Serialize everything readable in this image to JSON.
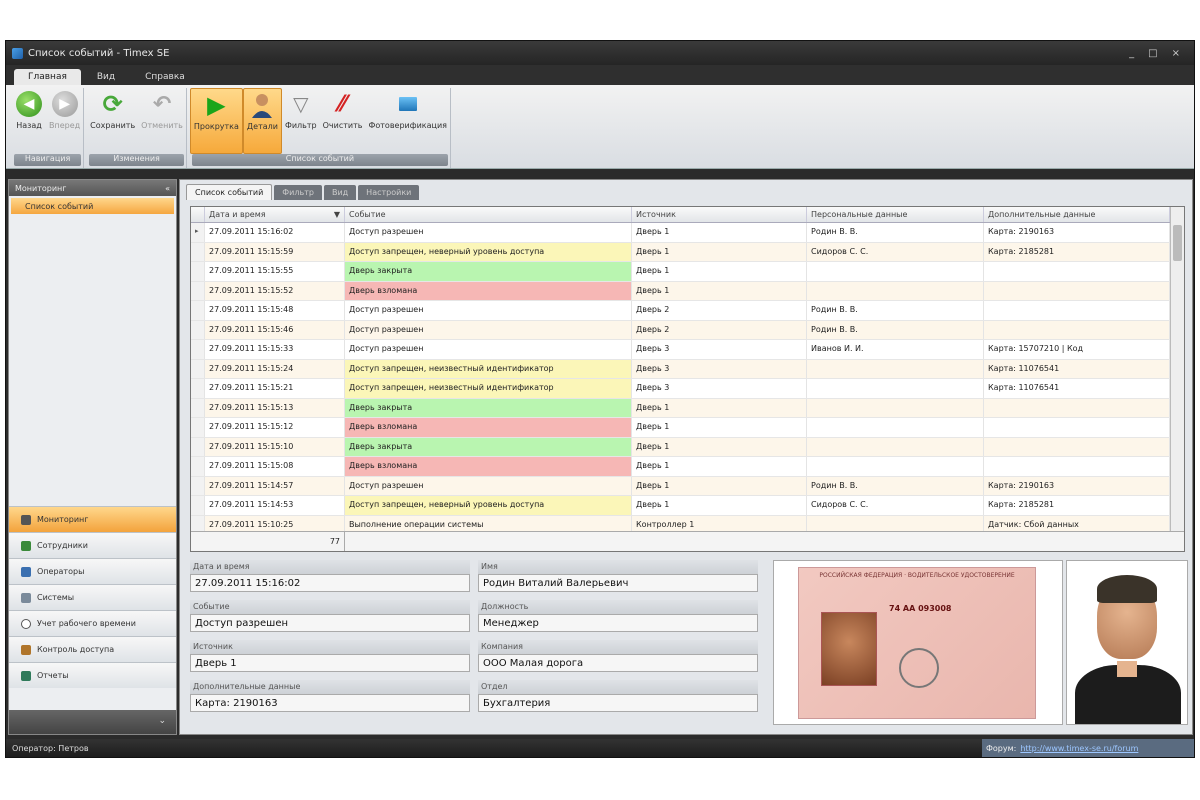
{
  "window": {
    "title": "Список событий - Timex SE",
    "controls": [
      "_",
      "□",
      "×"
    ]
  },
  "ribbon_tabs": [
    "Главная",
    "Вид",
    "Справка"
  ],
  "ribbon_groups": [
    {
      "label": "Навигация",
      "buttons": [
        {
          "label": "Назад",
          "icon": "back-icon"
        },
        {
          "label": "Вперед",
          "icon": "forward-icon"
        }
      ]
    },
    {
      "label": "Изменения",
      "buttons": [
        {
          "label": "Сохранить",
          "icon": "save-refresh-icon"
        },
        {
          "label": "Отменить",
          "icon": "undo-icon"
        }
      ]
    },
    {
      "label": "Список событий",
      "buttons": [
        {
          "label": "Прокрутка",
          "icon": "play-icon"
        },
        {
          "label": "Детали",
          "icon": "person-icon"
        },
        {
          "label": "Фильтр",
          "icon": "funnel-icon"
        },
        {
          "label": "Очистить",
          "icon": "eraser-icon"
        },
        {
          "label": "Фотоверификация",
          "icon": "photo-icon"
        }
      ]
    }
  ],
  "sidebar": {
    "header": "Мониторинг",
    "collapse_glyph": "«",
    "selected_item": "Список событий",
    "nav": [
      {
        "label": "Мониторинг",
        "icon": "monitor-icon"
      },
      {
        "label": "Сотрудники",
        "icon": "employees-icon"
      },
      {
        "label": "Операторы",
        "icon": "operators-icon"
      },
      {
        "label": "Системы",
        "icon": "systems-icon"
      },
      {
        "label": "Учет рабочего времени",
        "icon": "clock-icon"
      },
      {
        "label": "Контроль доступа",
        "icon": "door-icon"
      },
      {
        "label": "Отчеты",
        "icon": "reports-icon"
      }
    ],
    "bottom_glyph": "⌄"
  },
  "view_tabs": [
    "Список событий",
    "Фильтр",
    "Вид",
    "Настройки"
  ],
  "grid": {
    "columns": [
      "Дата и время",
      "Событие",
      "Источник",
      "Персональные данные",
      "Дополнительные данные"
    ],
    "sort_glyph": "▼",
    "current_row_glyph": "▸",
    "rows": [
      {
        "dt": "27.09.2011 15:16:02",
        "event": "Доступ разрешен",
        "src": "Дверь 1",
        "person": "Родин В. В.",
        "extra": "Карта: 2190163",
        "tone": "none"
      },
      {
        "dt": "27.09.2011 15:15:59",
        "event": "Доступ запрещен, неверный уровень доступа",
        "src": "Дверь 1",
        "person": "Сидоров С. С.",
        "extra": "Карта: 2185281",
        "tone": "yellow"
      },
      {
        "dt": "27.09.2011 15:15:55",
        "event": "Дверь закрыта",
        "src": "Дверь 1",
        "person": "",
        "extra": "",
        "tone": "green"
      },
      {
        "dt": "27.09.2011 15:15:52",
        "event": "Дверь взломана",
        "src": "Дверь 1",
        "person": "",
        "extra": "",
        "tone": "red"
      },
      {
        "dt": "27.09.2011 15:15:48",
        "event": "Доступ разрешен",
        "src": "Дверь 2",
        "person": "Родин В. В.",
        "extra": "",
        "tone": "none"
      },
      {
        "dt": "27.09.2011 15:15:46",
        "event": "Доступ разрешен",
        "src": "Дверь 2",
        "person": "Родин В. В.",
        "extra": "",
        "tone": "none"
      },
      {
        "dt": "27.09.2011 15:15:33",
        "event": "Доступ разрешен",
        "src": "Дверь 3",
        "person": "Иванов И. И.",
        "extra": "Карта: 15707210 | Код",
        "tone": "none"
      },
      {
        "dt": "27.09.2011 15:15:24",
        "event": "Доступ запрещен, неизвестный идентификатор",
        "src": "Дверь 3",
        "person": "",
        "extra": "Карта: 11076541",
        "tone": "yellow"
      },
      {
        "dt": "27.09.2011 15:15:21",
        "event": "Доступ запрещен, неизвестный идентификатор",
        "src": "Дверь 3",
        "person": "",
        "extra": "Карта: 11076541",
        "tone": "yellow"
      },
      {
        "dt": "27.09.2011 15:15:13",
        "event": "Дверь закрыта",
        "src": "Дверь 1",
        "person": "",
        "extra": "",
        "tone": "green"
      },
      {
        "dt": "27.09.2011 15:15:12",
        "event": "Дверь взломана",
        "src": "Дверь 1",
        "person": "",
        "extra": "",
        "tone": "red"
      },
      {
        "dt": "27.09.2011 15:15:10",
        "event": "Дверь закрыта",
        "src": "Дверь 1",
        "person": "",
        "extra": "",
        "tone": "green"
      },
      {
        "dt": "27.09.2011 15:15:08",
        "event": "Дверь взломана",
        "src": "Дверь 1",
        "person": "",
        "extra": "",
        "tone": "red"
      },
      {
        "dt": "27.09.2011 15:14:57",
        "event": "Доступ разрешен",
        "src": "Дверь 1",
        "person": "Родин В. В.",
        "extra": "Карта: 2190163",
        "tone": "none"
      },
      {
        "dt": "27.09.2011 15:14:53",
        "event": "Доступ запрещен, неверный уровень доступа",
        "src": "Дверь 1",
        "person": "Сидоров С. С.",
        "extra": "Карта: 2185281",
        "tone": "yellow"
      },
      {
        "dt": "27.09.2011 15:10:25",
        "event": "Выполнение операции системы",
        "src": "Контроллер 1",
        "person": "",
        "extra": "Датчик: Сбой данных",
        "tone": "none"
      }
    ],
    "count": "77"
  },
  "details": {
    "labels": {
      "datetime": "Дата и время",
      "name": "Имя",
      "event": "Событие",
      "position": "Должность",
      "source": "Источник",
      "company": "Компания",
      "extra": "Дополнительные данные",
      "department": "Отдел"
    },
    "values": {
      "datetime": "27.09.2011 15:16:02",
      "name": "Родин Виталий Валерьевич",
      "event": "Доступ разрешен",
      "position": "Менеджер",
      "source": "Дверь 1",
      "company": "ООО Малая дорога",
      "extra": "Карта: 2190163",
      "department": "Бухгалтерия"
    }
  },
  "document": {
    "header": "РОССИЙСКАЯ ФЕДЕРАЦИЯ · ВОДИТЕЛЬСКОЕ УДОСТОВЕРЕНИЕ",
    "number": "74 АА 093008"
  },
  "statusbar": {
    "operator": "Оператор: Петров",
    "forum_label": "Форум:",
    "forum_link": "http://www.timex-se.ru/forum"
  },
  "colors": {
    "accent_orange": "#f5a640",
    "row_green": "#b9f5b0",
    "row_red": "#f6b7b5",
    "row_yellow": "#fbf6b8"
  }
}
